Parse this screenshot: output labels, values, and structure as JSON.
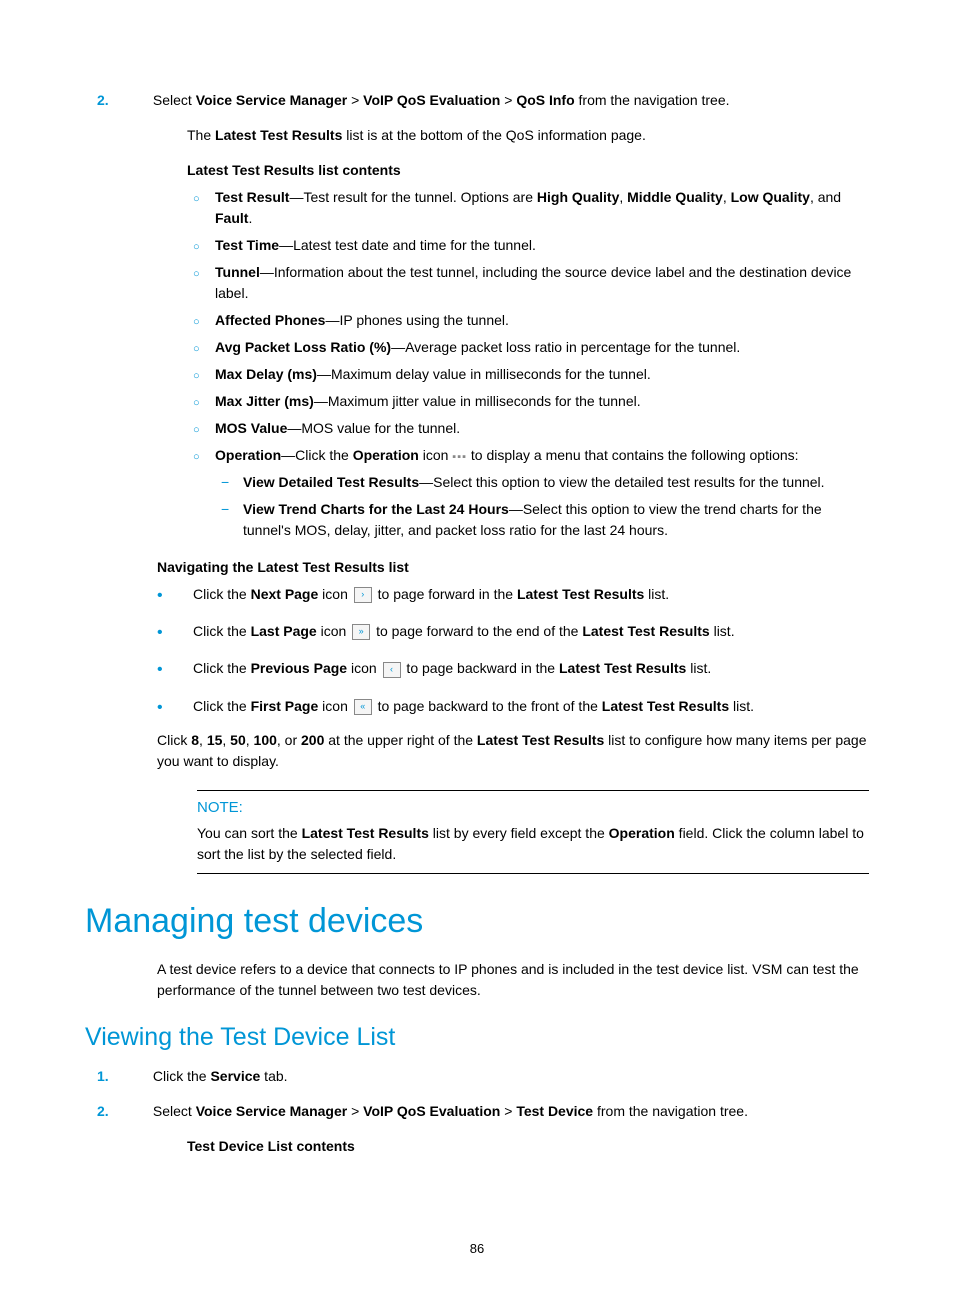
{
  "step2": {
    "num": "2.",
    "pre": "Select ",
    "b1": "Voice Service Manager",
    "sep1": " > ",
    "b2": "VoIP QoS Evaluation",
    "sep2": " > ",
    "b3": "QoS Info",
    "post": " from the navigation tree."
  },
  "intro": {
    "pre": "The ",
    "b": "Latest Test Results",
    "post": " list is at the bottom of the QoS information page."
  },
  "contentsHead": "Latest Test Results list contents",
  "items": {
    "tr": {
      "b": "Test Result",
      "t1": "—Test result for the tunnel. Options are ",
      "o1": "High Quality",
      "c1": ", ",
      "o2": "Middle Quality",
      "c2": ", ",
      "o3": "Low Quality",
      "c3": ", and ",
      "o4": "Fault",
      "end": "."
    },
    "tt": {
      "b": "Test Time",
      "t": "—Latest test date and time for the tunnel."
    },
    "tn": {
      "b": "Tunnel",
      "t": "—Information about the test tunnel, including the source device label and the destination device label."
    },
    "ap": {
      "b": "Affected Phones",
      "t": "—IP phones using the tunnel."
    },
    "pl": {
      "b": "Avg Packet Loss Ratio (%)",
      "t": "—Average packet loss ratio in percentage for the tunnel."
    },
    "md": {
      "b": "Max Delay (ms)",
      "t": "—Maximum delay value in milliseconds for the tunnel."
    },
    "mj": {
      "b": "Max Jitter (ms)",
      "t": "—Maximum jitter value in milliseconds for the tunnel."
    },
    "mv": {
      "b": "MOS Value",
      "t": "—MOS value for the tunnel."
    },
    "op": {
      "b": "Operation",
      "t1": "—Click the ",
      "b2": "Operation",
      "t2": " icon ",
      "t3": " to display a menu that contains the following options:"
    }
  },
  "opsub": {
    "d1b": "View Detailed Test Results",
    "d1t": "—Select this option to view the detailed test results for the tunnel.",
    "d2b": "View Trend Charts for the Last 24 Hours",
    "d2t": "—Select this option to view the trend charts for the tunnel's MOS, delay, jitter, and packet loss ratio for the last 24 hours."
  },
  "navHead": "Navigating the Latest Test Results list",
  "nav": {
    "n1": {
      "pre": "Click the ",
      "b": "Next Page",
      "mid": " icon ",
      "post1": " to page forward in the ",
      "b2": "Latest Test Results",
      "post2": " list."
    },
    "n2": {
      "pre": "Click the ",
      "b": "Last Page",
      "mid": " icon ",
      "post1": " to page forward to the end of the ",
      "b2": "Latest Test Results",
      "post2": " list."
    },
    "n3": {
      "pre": "Click the ",
      "b": "Previous Page",
      "mid": " icon ",
      "post1": " to page backward in the ",
      "b2": "Latest Test Results",
      "post2": " list."
    },
    "n4": {
      "pre": "Click the ",
      "b": "First Page",
      "mid": " icon ",
      "post1": " to page backward to the front of the ",
      "b2": "Latest Test Results",
      "post2": " list."
    }
  },
  "pagerPara": {
    "pre": "Click ",
    "v1": "8",
    "c": ", ",
    "v2": "15",
    "v3": "50",
    "v4": "100",
    "or": ", or ",
    "v5": "200",
    "mid": " at the upper right of the ",
    "b": "Latest Test Results",
    "post": " list to configure how many items per page you want to display."
  },
  "note": {
    "label": "NOTE:",
    "t1": "You can sort the ",
    "b1": "Latest Test Results",
    "t2": " list by every field except the ",
    "b2": "Operation",
    "t3": " field. Click the column label to sort the list by the selected field."
  },
  "h1": "Managing test devices",
  "mgrPara": "A test device refers to a device that connects to IP phones and is included in the test device list. VSM can test the performance of the tunnel between two test devices.",
  "h2": "Viewing the Test Device List",
  "vl": {
    "s1": {
      "num": "1.",
      "pre": "Click the ",
      "b": "Service",
      "post": " tab."
    },
    "s2": {
      "num": "2.",
      "pre": "Select ",
      "b1": "Voice Service Manager",
      "sep": " > ",
      "b2": "VoIP QoS Evaluation",
      "b3": "Test Device",
      "post": " from the navigation tree."
    },
    "sub": "Test Device List contents"
  },
  "pageNumber": "86",
  "icons": {
    "next": "›",
    "last": "»",
    "prev": "‹",
    "first": "«",
    "dots": "▪▪▪"
  }
}
